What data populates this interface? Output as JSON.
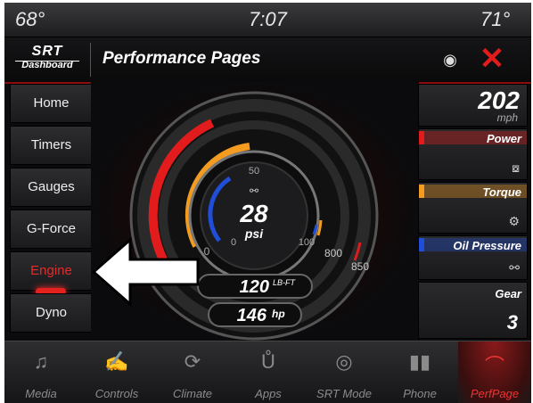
{
  "status": {
    "temp_left": "68°",
    "time": "7:07",
    "temp_right": "71°"
  },
  "header": {
    "brand_top": "SRT",
    "brand_bottom": "Dashboard",
    "title": "Performance Pages"
  },
  "sidebar": {
    "items": [
      {
        "label": "Home"
      },
      {
        "label": "Timers"
      },
      {
        "label": "Gauges"
      },
      {
        "label": "G-Force"
      },
      {
        "label": "Engine"
      },
      {
        "label": "Dyno"
      }
    ],
    "active": "Engine"
  },
  "gauge": {
    "boost_value": "28",
    "boost_unit": "psi",
    "boost_ticks": {
      "low": "0",
      "mid": "50",
      "high": "100"
    },
    "outer_ticks": {
      "low": "0",
      "a": "800",
      "b": "850"
    },
    "torque_value": "120",
    "torque_unit": "LB-FT",
    "power_value": "146",
    "power_unit": "hp"
  },
  "right": {
    "speed": "202",
    "speed_unit": "mph",
    "power_label": "Power",
    "torque_label": "Torque",
    "oil_label": "Oil Pressure",
    "gear_label": "Gear",
    "gear_value": "3"
  },
  "bottom": {
    "tabs": [
      {
        "label": "Media",
        "icon": "music-note-icon"
      },
      {
        "label": "Controls",
        "icon": "controls-icon"
      },
      {
        "label": "Climate",
        "icon": "climate-icon"
      },
      {
        "label": "Apps",
        "icon": "apps-icon"
      },
      {
        "label": "SRT Mode",
        "icon": "srt-mode-icon"
      },
      {
        "label": "Phone",
        "icon": "phone-icon"
      },
      {
        "label": "PerfPage",
        "icon": "perfpage-icon"
      }
    ]
  },
  "colors": {
    "accent": "#e21c1c",
    "torque": "#f39c1f",
    "oil": "#1f4fd8"
  }
}
